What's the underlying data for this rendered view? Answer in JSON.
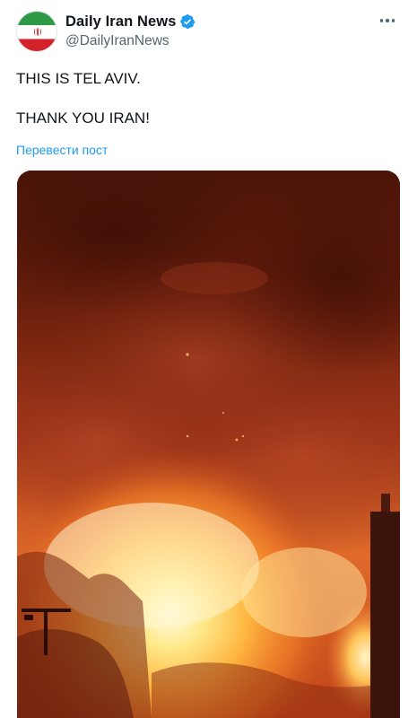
{
  "author": {
    "display_name": "Daily Iran News",
    "handle": "@DailyIranNews",
    "avatar_icon": "iran-flag-icon",
    "verified_icon": "verified-badge-icon",
    "verified_color": "#1d9bf0"
  },
  "menu": {
    "icon": "more-options-icon"
  },
  "tweet": {
    "lines": [
      "THIS IS TEL AVIV.",
      "THANK YOU IRAN!"
    ]
  },
  "translate": {
    "label": "Перевести пост",
    "color": "#1d9bf0"
  },
  "media": {
    "type": "video-still",
    "subject": "night explosion fire"
  }
}
